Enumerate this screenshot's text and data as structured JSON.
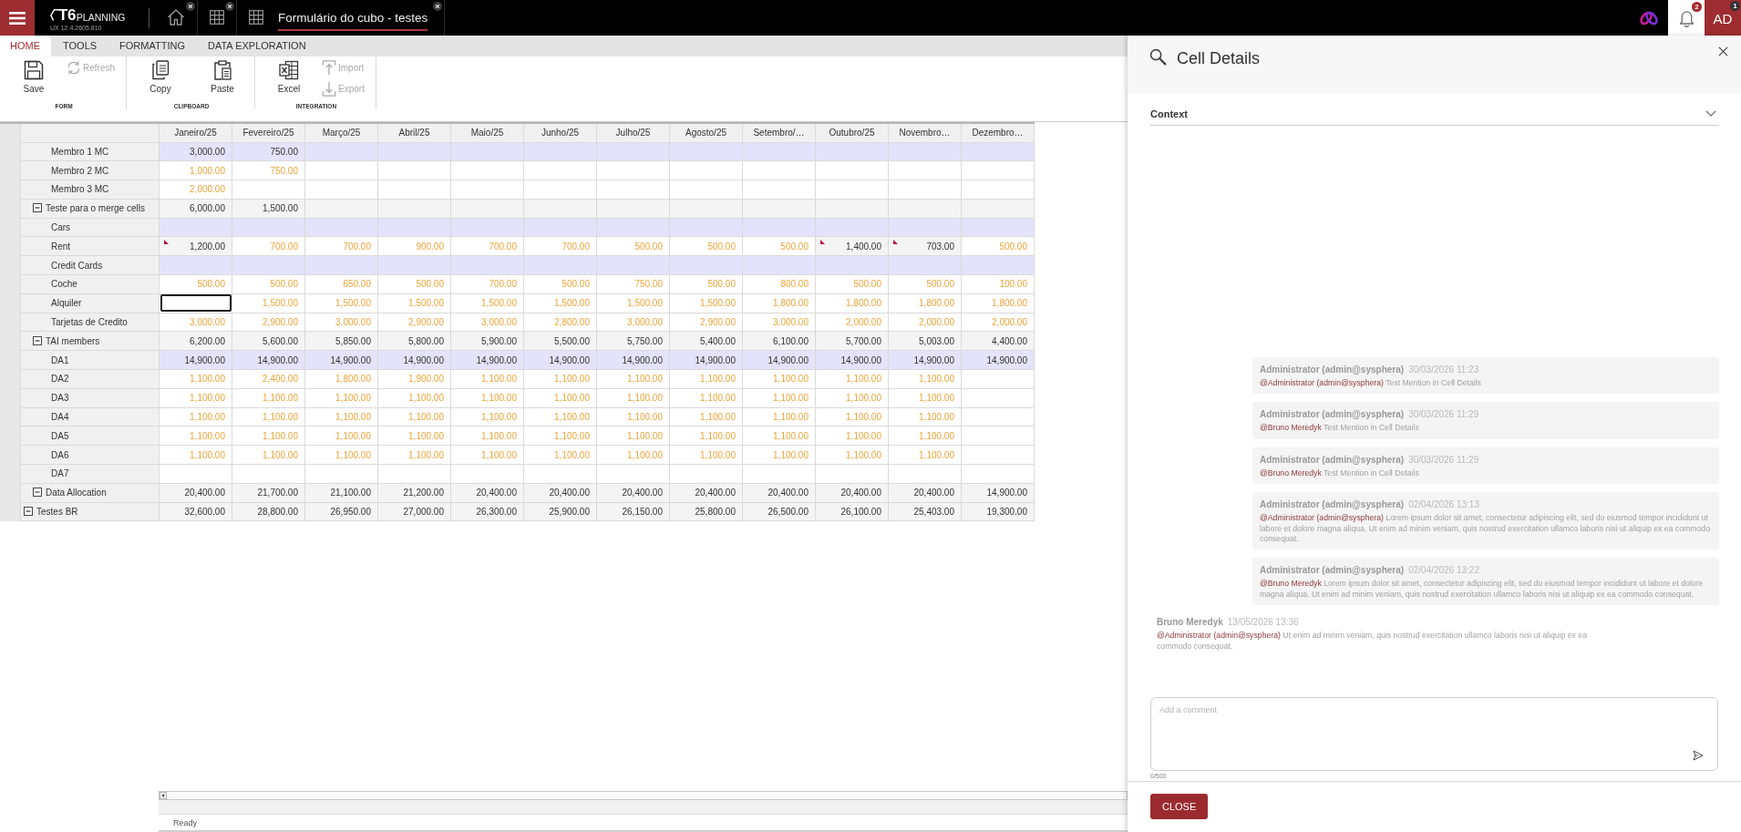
{
  "top_bar": {
    "logo": {
      "mark": "T6",
      "name": "PLANNING",
      "version": "UX 12.4.2605.810"
    },
    "tabs": [
      {
        "selected": false
      },
      {
        "selected": false
      },
      {
        "title": "Formulário do cubo - testes",
        "selected": true
      }
    ],
    "notifications": {
      "badge": "2"
    },
    "user": {
      "initials": "AD",
      "badge": "1"
    }
  },
  "ribbon": {
    "tabs": [
      {
        "label": "HOME",
        "selected": true
      },
      {
        "label": "TOOLS",
        "selected": false
      },
      {
        "label": "FORMATTING",
        "selected": false
      },
      {
        "label": "DATA EXPLORATION",
        "selected": false
      }
    ],
    "groups": [
      {
        "label": "FORM",
        "buttons": [
          {
            "label": "Save",
            "kind": "large",
            "disabled": false
          },
          {
            "label": "Refresh",
            "kind": "small",
            "disabled": true
          }
        ]
      },
      {
        "label": "CLIPBOARD",
        "buttons": [
          {
            "label": "Copy",
            "kind": "large",
            "disabled": false
          },
          {
            "label": "Paste",
            "kind": "large",
            "disabled": false
          }
        ]
      },
      {
        "label": "INTEGRATION",
        "buttons": [
          {
            "label": "Excel",
            "kind": "large",
            "disabled": false
          },
          {
            "label": "Import",
            "kind": "small",
            "disabled": true
          },
          {
            "label": "Export",
            "kind": "small",
            "disabled": true
          }
        ]
      }
    ]
  },
  "grid": {
    "columns": [
      "Janeiro/25",
      "Fevereiro/25",
      "Março/25",
      "Abril/25",
      "Maio/25",
      "Junho/25",
      "Julho/25",
      "Agosto/25",
      "Setembro/…",
      "Outubro/25",
      "Novembro…",
      "Dezembro…"
    ],
    "rows": [
      {
        "label": "Testes BR",
        "expanded": true,
        "highlighted": false,
        "cells": [
          {
            "value": "32,600.00",
            "kind": "calc",
            "selected": false
          },
          {
            "value": "28,800.00",
            "kind": "calc",
            "selected": false
          },
          {
            "value": "26,950.00",
            "kind": "calc",
            "selected": false
          },
          {
            "value": "27,000.00",
            "kind": "calc",
            "selected": false
          },
          {
            "value": "26,300.00",
            "kind": "calc",
            "selected": false
          },
          {
            "value": "25,900.00",
            "kind": "calc",
            "selected": false
          },
          {
            "value": "26,150.00",
            "kind": "calc",
            "selected": false
          },
          {
            "value": "25,800.00",
            "kind": "calc",
            "selected": false
          },
          {
            "value": "26,500.00",
            "kind": "calc",
            "selected": false
          },
          {
            "value": "26,100.00",
            "kind": "calc",
            "selected": false
          },
          {
            "value": "25,403.00",
            "kind": "calc",
            "selected": false
          },
          {
            "value": "19,300.00",
            "kind": "calc",
            "selected": false
          }
        ],
        "children": [
          {
            "label": "Teste para o merge cells",
            "expanded": true,
            "highlighted": false,
            "cells": [
              {
                "value": "6,000.00",
                "kind": "calc",
                "selected": false
              },
              {
                "value": "1,500.00",
                "kind": "calc",
                "selected": false
              },
              {
                "selected": false
              },
              {
                "selected": false
              },
              {
                "selected": false
              },
              {
                "selected": false
              },
              {
                "selected": false
              },
              {
                "selected": false
              },
              {
                "selected": false
              },
              {
                "selected": false
              },
              {
                "selected": false
              },
              {
                "selected": false
              }
            ],
            "children": [
              {
                "label": "Membro 1 MC",
                "highlighted": true,
                "cells": [
                  {
                    "value": "3,000.00",
                    "kind": "calc",
                    "selected": false
                  },
                  {
                    "value": "750.00",
                    "kind": "calc",
                    "selected": false
                  },
                  {
                    "selected": false
                  },
                  {
                    "selected": false
                  },
                  {
                    "selected": false
                  },
                  {
                    "selected": false
                  },
                  {
                    "selected": false
                  },
                  {
                    "selected": false
                  },
                  {
                    "selected": false
                  },
                  {
                    "selected": false
                  },
                  {
                    "selected": false
                  },
                  {
                    "selected": false
                  }
                ]
              },
              {
                "label": "Membro 2 MC",
                "highlighted": false,
                "cells": [
                  {
                    "value": "1,000.00",
                    "kind": "input",
                    "selected": false
                  },
                  {
                    "value": "750.00",
                    "kind": "input",
                    "selected": false
                  },
                  {
                    "selected": false
                  },
                  {
                    "selected": false
                  },
                  {
                    "selected": false
                  },
                  {
                    "selected": false
                  },
                  {
                    "selected": false
                  },
                  {
                    "selected": false
                  },
                  {
                    "selected": false
                  },
                  {
                    "selected": false
                  },
                  {
                    "selected": false
                  },
                  {
                    "selected": false
                  }
                ]
              },
              {
                "label": "Membro 3 MC",
                "highlighted": false,
                "cells": [
                  {
                    "value": "2,000.00",
                    "kind": "input",
                    "selected": false
                  },
                  {
                    "selected": false
                  },
                  {
                    "selected": false
                  },
                  {
                    "selected": false
                  },
                  {
                    "selected": false
                  },
                  {
                    "selected": false
                  },
                  {
                    "selected": false
                  },
                  {
                    "selected": false
                  },
                  {
                    "selected": false
                  },
                  {
                    "selected": false
                  },
                  {
                    "selected": false
                  },
                  {
                    "selected": false
                  }
                ]
              }
            ]
          },
          {
            "label": "TAI members",
            "expanded": true,
            "highlighted": false,
            "cells": [
              {
                "value": "6,200.00",
                "kind": "calc",
                "selected": false
              },
              {
                "value": "5,600.00",
                "kind": "calc",
                "selected": false
              },
              {
                "value": "5,850.00",
                "kind": "calc",
                "selected": false
              },
              {
                "value": "5,800.00",
                "kind": "calc",
                "selected": false
              },
              {
                "value": "5,900.00",
                "kind": "calc",
                "selected": false
              },
              {
                "value": "5,500.00",
                "kind": "calc",
                "selected": false
              },
              {
                "value": "5,750.00",
                "kind": "calc",
                "selected": false
              },
              {
                "value": "5,400.00",
                "kind": "calc",
                "selected": false
              },
              {
                "value": "6,100.00",
                "kind": "calc",
                "selected": false
              },
              {
                "value": "5,700.00",
                "kind": "calc",
                "selected": false
              },
              {
                "value": "5,003.00",
                "kind": "calc",
                "selected": false
              },
              {
                "value": "4,400.00",
                "kind": "calc",
                "selected": false
              }
            ],
            "children": [
              {
                "label": "Cars",
                "highlighted": true,
                "cells": [
                  {
                    "selected": false
                  },
                  {
                    "selected": false
                  },
                  {
                    "selected": false
                  },
                  {
                    "selected": false
                  },
                  {
                    "selected": false
                  },
                  {
                    "selected": false
                  },
                  {
                    "selected": false
                  },
                  {
                    "selected": false
                  },
                  {
                    "selected": false
                  },
                  {
                    "selected": false
                  },
                  {
                    "selected": false
                  },
                  {
                    "selected": false
                  }
                ]
              },
              {
                "label": "Rent",
                "highlighted": false,
                "cells": [
                  {
                    "value": "1,200.00",
                    "kind": "note",
                    "selected": false
                  },
                  {
                    "value": "700.00",
                    "kind": "input",
                    "selected": false
                  },
                  {
                    "value": "700.00",
                    "kind": "input",
                    "selected": false
                  },
                  {
                    "value": "900.00",
                    "kind": "input",
                    "selected": false
                  },
                  {
                    "value": "700.00",
                    "kind": "input",
                    "selected": false
                  },
                  {
                    "value": "700.00",
                    "kind": "input",
                    "selected": false
                  },
                  {
                    "value": "500.00",
                    "kind": "input",
                    "selected": false
                  },
                  {
                    "value": "500.00",
                    "kind": "input",
                    "selected": false
                  },
                  {
                    "value": "500.00",
                    "kind": "input",
                    "selected": false
                  },
                  {
                    "value": "1,400.00",
                    "kind": "note",
                    "selected": false
                  },
                  {
                    "value": "703.00",
                    "kind": "note",
                    "selected": false
                  },
                  {
                    "value": "500.00",
                    "kind": "input",
                    "selected": false
                  }
                ]
              },
              {
                "label": "Credit Cards",
                "highlighted": true,
                "cells": [
                  {
                    "selected": false
                  },
                  {
                    "selected": false
                  },
                  {
                    "selected": false
                  },
                  {
                    "selected": false
                  },
                  {
                    "selected": false
                  },
                  {
                    "selected": false
                  },
                  {
                    "selected": false
                  },
                  {
                    "selected": false
                  },
                  {
                    "selected": false
                  },
                  {
                    "selected": false
                  },
                  {
                    "selected": false
                  },
                  {
                    "selected": false
                  }
                ]
              },
              {
                "label": "Coche",
                "highlighted": false,
                "cells": [
                  {
                    "value": "500.00",
                    "kind": "input",
                    "selected": false
                  },
                  {
                    "value": "500.00",
                    "kind": "input",
                    "selected": false
                  },
                  {
                    "value": "650.00",
                    "kind": "input",
                    "selected": false
                  },
                  {
                    "value": "500.00",
                    "kind": "input",
                    "selected": false
                  },
                  {
                    "value": "700.00",
                    "kind": "input",
                    "selected": false
                  },
                  {
                    "value": "500.00",
                    "kind": "input",
                    "selected": false
                  },
                  {
                    "value": "750.00",
                    "kind": "input",
                    "selected": false
                  },
                  {
                    "value": "500.00",
                    "kind": "input",
                    "selected": false
                  },
                  {
                    "value": "800.00",
                    "kind": "input",
                    "selected": false
                  },
                  {
                    "value": "500.00",
                    "kind": "input",
                    "selected": false
                  },
                  {
                    "value": "500.00",
                    "kind": "input",
                    "selected": false
                  },
                  {
                    "value": "100.00",
                    "kind": "input",
                    "selected": false
                  }
                ]
              },
              {
                "label": "Alquiler",
                "highlighted": false,
                "cells": [
                  {
                    "selected": true
                  },
                  {
                    "value": "1,500.00",
                    "kind": "input",
                    "selected": false
                  },
                  {
                    "value": "1,500.00",
                    "kind": "input",
                    "selected": false
                  },
                  {
                    "value": "1,500.00",
                    "kind": "input",
                    "selected": false
                  },
                  {
                    "value": "1,500.00",
                    "kind": "input",
                    "selected": false
                  },
                  {
                    "value": "1,500.00",
                    "kind": "input",
                    "selected": false
                  },
                  {
                    "value": "1,500.00",
                    "kind": "input",
                    "selected": false
                  },
                  {
                    "value": "1,500.00",
                    "kind": "input",
                    "selected": false
                  },
                  {
                    "value": "1,800.00",
                    "kind": "input",
                    "selected": false
                  },
                  {
                    "value": "1,800.00",
                    "kind": "input",
                    "selected": false
                  },
                  {
                    "value": "1,800.00",
                    "kind": "input",
                    "selected": false
                  },
                  {
                    "value": "1,800.00",
                    "kind": "input",
                    "selected": false
                  }
                ]
              },
              {
                "label": "Tarjetas de Credito",
                "highlighted": false,
                "cells": [
                  {
                    "value": "3,000.00",
                    "kind": "input",
                    "selected": false
                  },
                  {
                    "value": "2,900.00",
                    "kind": "input",
                    "selected": false
                  },
                  {
                    "value": "3,000.00",
                    "kind": "input",
                    "selected": false
                  },
                  {
                    "value": "2,900.00",
                    "kind": "input",
                    "selected": false
                  },
                  {
                    "value": "3,000.00",
                    "kind": "input",
                    "selected": false
                  },
                  {
                    "value": "2,800.00",
                    "kind": "input",
                    "selected": false
                  },
                  {
                    "value": "3,000.00",
                    "kind": "input",
                    "selected": false
                  },
                  {
                    "value": "2,900.00",
                    "kind": "input",
                    "selected": false
                  },
                  {
                    "value": "3,000.00",
                    "kind": "input",
                    "selected": false
                  },
                  {
                    "value": "2,000.00",
                    "kind": "input",
                    "selected": false
                  },
                  {
                    "value": "2,000.00",
                    "kind": "input",
                    "selected": false
                  },
                  {
                    "value": "2,000.00",
                    "kind": "input",
                    "selected": false
                  }
                ]
              }
            ]
          },
          {
            "label": "Data Allocation",
            "expanded": true,
            "highlighted": false,
            "cells": [
              {
                "value": "20,400.00",
                "kind": "calc",
                "selected": false
              },
              {
                "value": "21,700.00",
                "kind": "calc",
                "selected": false
              },
              {
                "value": "21,100.00",
                "kind": "calc",
                "selected": false
              },
              {
                "value": "21,200.00",
                "kind": "calc",
                "selected": false
              },
              {
                "value": "20,400.00",
                "kind": "calc",
                "selected": false
              },
              {
                "value": "20,400.00",
                "kind": "calc",
                "selected": false
              },
              {
                "value": "20,400.00",
                "kind": "calc",
                "selected": false
              },
              {
                "value": "20,400.00",
                "kind": "calc",
                "selected": false
              },
              {
                "value": "20,400.00",
                "kind": "calc",
                "selected": false
              },
              {
                "value": "20,400.00",
                "kind": "calc",
                "selected": false
              },
              {
                "value": "20,400.00",
                "kind": "calc",
                "selected": false
              },
              {
                "value": "14,900.00",
                "kind": "calc",
                "selected": false
              }
            ],
            "children": [
              {
                "label": "DA1",
                "highlighted": true,
                "cells": [
                  {
                    "value": "14,900.00",
                    "kind": "calc",
                    "selected": false
                  },
                  {
                    "value": "14,900.00",
                    "kind": "calc",
                    "selected": false
                  },
                  {
                    "value": "14,900.00",
                    "kind": "calc",
                    "selected": false
                  },
                  {
                    "value": "14,900.00",
                    "kind": "calc",
                    "selected": false
                  },
                  {
                    "value": "14,900.00",
                    "kind": "calc",
                    "selected": false
                  },
                  {
                    "value": "14,900.00",
                    "kind": "calc",
                    "selected": false
                  },
                  {
                    "value": "14,900.00",
                    "kind": "calc",
                    "selected": false
                  },
                  {
                    "value": "14,900.00",
                    "kind": "calc",
                    "selected": false
                  },
                  {
                    "value": "14,900.00",
                    "kind": "calc",
                    "selected": false
                  },
                  {
                    "value": "14,900.00",
                    "kind": "calc",
                    "selected": false
                  },
                  {
                    "value": "14,900.00",
                    "kind": "calc",
                    "selected": false
                  },
                  {
                    "value": "14,900.00",
                    "kind": "calc",
                    "selected": false
                  }
                ]
              },
              {
                "label": "DA2",
                "highlighted": false,
                "cells": [
                  {
                    "value": "1,100.00",
                    "kind": "input",
                    "selected": false
                  },
                  {
                    "value": "2,400.00",
                    "kind": "input",
                    "selected": false
                  },
                  {
                    "value": "1,800.00",
                    "kind": "input",
                    "selected": false
                  },
                  {
                    "value": "1,900.00",
                    "kind": "input",
                    "selected": false
                  },
                  {
                    "value": "1,100.00",
                    "kind": "input",
                    "selected": false
                  },
                  {
                    "value": "1,100.00",
                    "kind": "input",
                    "selected": false
                  },
                  {
                    "value": "1,100.00",
                    "kind": "input",
                    "selected": false
                  },
                  {
                    "value": "1,100.00",
                    "kind": "input",
                    "selected": false
                  },
                  {
                    "value": "1,100.00",
                    "kind": "input",
                    "selected": false
                  },
                  {
                    "value": "1,100.00",
                    "kind": "input",
                    "selected": false
                  },
                  {
                    "value": "1,100.00",
                    "kind": "input",
                    "selected": false
                  },
                  {
                    "selected": false
                  }
                ]
              },
              {
                "label": "DA3",
                "highlighted": false,
                "cells": [
                  {
                    "value": "1,100.00",
                    "kind": "input",
                    "selected": false
                  },
                  {
                    "value": "1,100.00",
                    "kind": "input",
                    "selected": false
                  },
                  {
                    "value": "1,100.00",
                    "kind": "input",
                    "selected": false
                  },
                  {
                    "value": "1,100.00",
                    "kind": "input",
                    "selected": false
                  },
                  {
                    "value": "1,100.00",
                    "kind": "input",
                    "selected": false
                  },
                  {
                    "value": "1,100.00",
                    "kind": "input",
                    "selected": false
                  },
                  {
                    "value": "1,100.00",
                    "kind": "input",
                    "selected": false
                  },
                  {
                    "value": "1,100.00",
                    "kind": "input",
                    "selected": false
                  },
                  {
                    "value": "1,100.00",
                    "kind": "input",
                    "selected": false
                  },
                  {
                    "value": "1,100.00",
                    "kind": "input",
                    "selected": false
                  },
                  {
                    "value": "1,100.00",
                    "kind": "input",
                    "selected": false
                  },
                  {
                    "selected": false
                  }
                ]
              },
              {
                "label": "DA4",
                "highlighted": false,
                "cells": [
                  {
                    "value": "1,100.00",
                    "kind": "input",
                    "selected": false
                  },
                  {
                    "value": "1,100.00",
                    "kind": "input",
                    "selected": false
                  },
                  {
                    "value": "1,100.00",
                    "kind": "input",
                    "selected": false
                  },
                  {
                    "value": "1,100.00",
                    "kind": "input",
                    "selected": false
                  },
                  {
                    "value": "1,100.00",
                    "kind": "input",
                    "selected": false
                  },
                  {
                    "value": "1,100.00",
                    "kind": "input",
                    "selected": false
                  },
                  {
                    "value": "1,100.00",
                    "kind": "input",
                    "selected": false
                  },
                  {
                    "value": "1,100.00",
                    "kind": "input",
                    "selected": false
                  },
                  {
                    "value": "1,100.00",
                    "kind": "input",
                    "selected": false
                  },
                  {
                    "value": "1,100.00",
                    "kind": "input",
                    "selected": false
                  },
                  {
                    "value": "1,100.00",
                    "kind": "input",
                    "selected": false
                  },
                  {
                    "selected": false
                  }
                ]
              },
              {
                "label": "DA5",
                "highlighted": false,
                "cells": [
                  {
                    "value": "1,100.00",
                    "kind": "input",
                    "selected": false
                  },
                  {
                    "value": "1,100.00",
                    "kind": "input",
                    "selected": false
                  },
                  {
                    "value": "1,100.00",
                    "kind": "input",
                    "selected": false
                  },
                  {
                    "value": "1,100.00",
                    "kind": "input",
                    "selected": false
                  },
                  {
                    "value": "1,100.00",
                    "kind": "input",
                    "selected": false
                  },
                  {
                    "value": "1,100.00",
                    "kind": "input",
                    "selected": false
                  },
                  {
                    "value": "1,100.00",
                    "kind": "input",
                    "selected": false
                  },
                  {
                    "value": "1,100.00",
                    "kind": "input",
                    "selected": false
                  },
                  {
                    "value": "1,100.00",
                    "kind": "input",
                    "selected": false
                  },
                  {
                    "value": "1,100.00",
                    "kind": "input",
                    "selected": false
                  },
                  {
                    "value": "1,100.00",
                    "kind": "input",
                    "selected": false
                  },
                  {
                    "selected": false
                  }
                ]
              },
              {
                "label": "DA6",
                "highlighted": false,
                "cells": [
                  {
                    "value": "1,100.00",
                    "kind": "input",
                    "selected": false
                  },
                  {
                    "value": "1,100.00",
                    "kind": "input",
                    "selected": false
                  },
                  {
                    "value": "1,100.00",
                    "kind": "input",
                    "selected": false
                  },
                  {
                    "value": "1,100.00",
                    "kind": "input",
                    "selected": false
                  },
                  {
                    "value": "1,100.00",
                    "kind": "input",
                    "selected": false
                  },
                  {
                    "value": "1,100.00",
                    "kind": "input",
                    "selected": false
                  },
                  {
                    "value": "1,100.00",
                    "kind": "input",
                    "selected": false
                  },
                  {
                    "value": "1,100.00",
                    "kind": "input",
                    "selected": false
                  },
                  {
                    "value": "1,100.00",
                    "kind": "input",
                    "selected": false
                  },
                  {
                    "value": "1,100.00",
                    "kind": "input",
                    "selected": false
                  },
                  {
                    "value": "1,100.00",
                    "kind": "input",
                    "selected": false
                  },
                  {
                    "selected": false
                  }
                ]
              },
              {
                "label": "DA7",
                "highlighted": false,
                "cells": [
                  {
                    "selected": false
                  },
                  {
                    "selected": false
                  },
                  {
                    "selected": false
                  },
                  {
                    "selected": false
                  },
                  {
                    "selected": false
                  },
                  {
                    "selected": false
                  },
                  {
                    "selected": false
                  },
                  {
                    "selected": false
                  },
                  {
                    "selected": false
                  },
                  {
                    "selected": false
                  },
                  {
                    "selected": false
                  },
                  {
                    "selected": false
                  }
                ]
              }
            ]
          }
        ]
      }
    ],
    "status": "Ready"
  },
  "cell_details": {
    "title": "Cell Details",
    "section": {
      "label": "Context",
      "expanded": false
    },
    "comments": [
      {
        "kind": "outgoing",
        "author": "Administrator (admin@sysphera)",
        "time": "30/03/2026 11:23",
        "mention": "@Administrator (admin@sysphera)",
        "text": "Test Mention in Cell Details"
      },
      {
        "kind": "outgoing",
        "author": "Administrator (admin@sysphera)",
        "time": "30/03/2026 11:29",
        "mention": "@Bruno Meredyk",
        "text": "Test Mention in Cell Details"
      },
      {
        "kind": "outgoing",
        "author": "Administrator (admin@sysphera)",
        "time": "30/03/2026 11:29",
        "mention": "@Bruno Meredyk",
        "text": "Test Mention in Cell Details"
      },
      {
        "kind": "outgoing",
        "author": "Administrator (admin@sysphera)",
        "time": "02/04/2026 13:13",
        "mention": "@Administrator (admin@sysphera)",
        "text": "Lorem ipsum dolor sit amet, consectetur adipiscing elit, sed do eiusmod tempor incididunt ut labore et dolore magna aliqua. Ut enim ad minim veniam, quis nostrud exercitation ullamco laboris nisi ut aliquip ex ea commodo consequat."
      },
      {
        "kind": "outgoing",
        "author": "Administrator (admin@sysphera)",
        "time": "02/04/2026 13:22",
        "mention": "@Bruno Meredyk",
        "text": "Lorem ipsum dolor sit amet, consectetur adipiscing elit, sed do eiusmod tempor incididunt ut labore et dolore magna aliqua. Ut enim ad minim veniam, quis nostrud exercitation ullamco laboris nisi ut aliquip ex ea commodo consequat."
      },
      {
        "kind": "incoming",
        "author": "Bruno Meredyk",
        "time": "13/05/2026 13:36",
        "mention": "@Administrator (admin@sysphera)",
        "text": "Ut enim ad minim veniam, quis nostrud exercitation ullamco laboris nisi ut aliquip ex ea commodo consequat."
      }
    ],
    "comment_box": {
      "placeholder": "Add a comment",
      "counter": "0/500"
    },
    "close_button": "CLOSE"
  }
}
